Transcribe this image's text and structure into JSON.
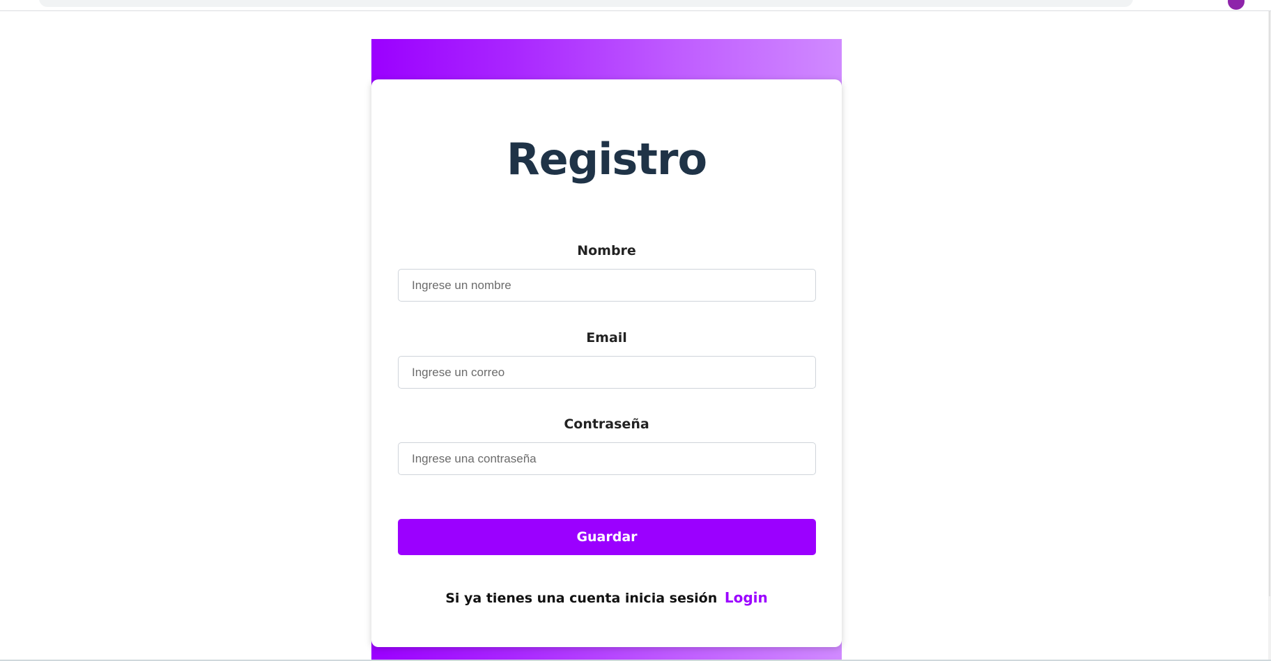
{
  "form": {
    "title": "Registro",
    "fields": [
      {
        "label": "Nombre",
        "placeholder": "Ingrese un nombre",
        "value": ""
      },
      {
        "label": "Email",
        "placeholder": "Ingrese un correo",
        "value": ""
      },
      {
        "label": "Contraseña",
        "placeholder": "Ingrese una contraseña",
        "value": ""
      }
    ],
    "submit_label": "Guardar",
    "login_prompt": "Si ya tienes una cuenta inicia sesión",
    "login_link": "Login"
  },
  "colors": {
    "accent": "#9b00ff",
    "title": "#1f3347",
    "gradient_start": "#9b00ff",
    "gradient_end": "#d08aff"
  }
}
